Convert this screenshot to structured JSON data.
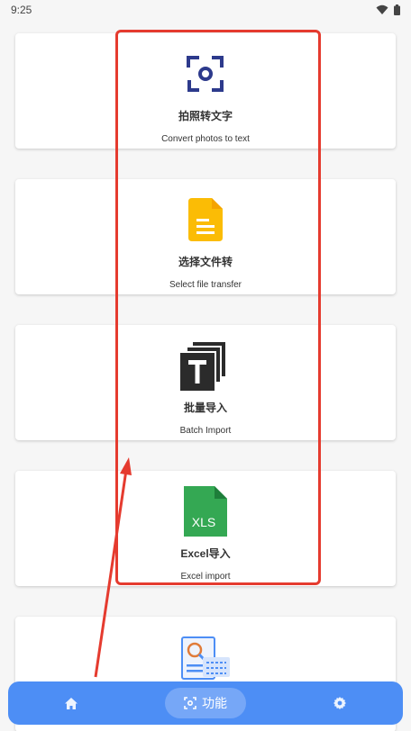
{
  "status": {
    "time": "9:25",
    "icons": [
      "wifi-icon",
      "battery-icon"
    ]
  },
  "cards": [
    {
      "icon": "scan-camera-icon",
      "title": "拍照转文字",
      "subtitle": "Convert photos to text"
    },
    {
      "icon": "document-icon",
      "title": "选择文件转",
      "subtitle": "Select file transfer"
    },
    {
      "icon": "text-stack-icon",
      "title": "批量导入",
      "subtitle": "Batch Import"
    },
    {
      "icon": "xls-file-icon",
      "icon_text": "XLS",
      "title": "Excel导入",
      "subtitle": "Excel import"
    },
    {
      "icon": "image-scan-icon",
      "title": "",
      "subtitle": ""
    }
  ],
  "bottom_nav": {
    "items": [
      {
        "icon": "home-icon"
      },
      {
        "icon": "scan-icon",
        "label": "功能",
        "active": true
      },
      {
        "icon": "gear-icon"
      }
    ]
  },
  "annotation": {
    "color": "#e53b2f"
  },
  "colors": {
    "nav_bg": "#4d8ef5",
    "nav_pill": "#76a7f7",
    "scan_blue": "#2d3a8c",
    "doc_yellow": "#fbbc05",
    "excel_green": "#34a853"
  }
}
